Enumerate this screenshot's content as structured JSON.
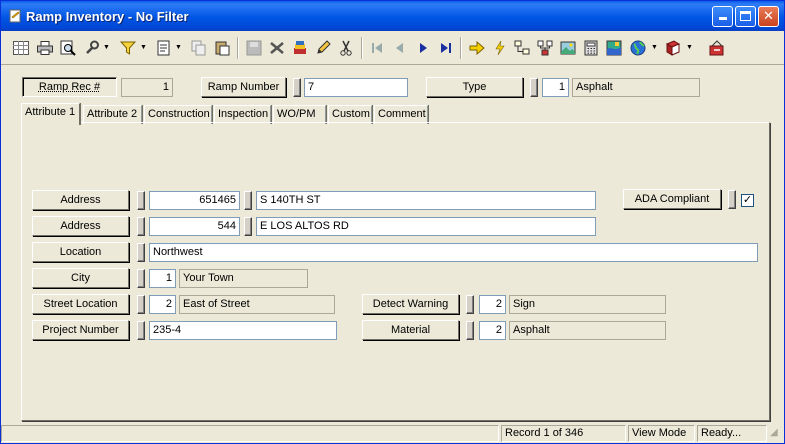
{
  "window": {
    "title": "Ramp Inventory - No Filter"
  },
  "icons": [
    "grid-icon",
    "print-icon",
    "print-preview-icon",
    "tools-icon",
    "filter-icon",
    "report-icon",
    "copy-icon",
    "paste-icon",
    "save-icon",
    "delete-icon",
    "post-icon",
    "edit-icon",
    "cut-icon",
    "first-record-icon",
    "previous-record-icon",
    "next-record-icon",
    "last-record-icon",
    "go-icon",
    "lightning-icon",
    "tree-icon",
    "network-icon",
    "image-icon",
    "calculator-icon",
    "map-icon",
    "globe-icon",
    "book-icon",
    "exit-icon"
  ],
  "header": {
    "ramp_rec_label": "Ramp Rec #",
    "ramp_rec_value": "1",
    "ramp_number_label": "Ramp Number",
    "ramp_number_value": "7",
    "type_label": "Type",
    "type_code": "1",
    "type_desc": "Asphalt"
  },
  "tabs": [
    {
      "label": "Attribute 1"
    },
    {
      "label": "Attribute 2"
    },
    {
      "label": "Construction"
    },
    {
      "label": "Inspection"
    },
    {
      "label": "WO/PM"
    },
    {
      "label": "Custom"
    },
    {
      "label": "Comment"
    }
  ],
  "form": {
    "address1_label": "Address",
    "address1_number": "651465",
    "address1_street": "S 140TH ST",
    "address2_label": "Address",
    "address2_number": "544",
    "address2_street": "E LOS ALTOS RD",
    "location_label": "Location",
    "location_value": "Northwest",
    "city_label": "City",
    "city_code": "1",
    "city_desc": "Your Town",
    "street_location_label": "Street Location",
    "street_location_code": "2",
    "street_location_desc": "East of Street",
    "project_number_label": "Project Number",
    "project_number_value": "235-4",
    "ada_label": "ADA Compliant",
    "ada_checked": "✓",
    "detect_warning_label": "Detect Warning",
    "detect_warning_code": "2",
    "detect_warning_desc": "Sign",
    "material_label": "Material",
    "material_code": "2",
    "material_desc": "Asphalt"
  },
  "status": {
    "record": "Record 1 of 346",
    "mode": "View Mode",
    "state": "Ready..."
  }
}
